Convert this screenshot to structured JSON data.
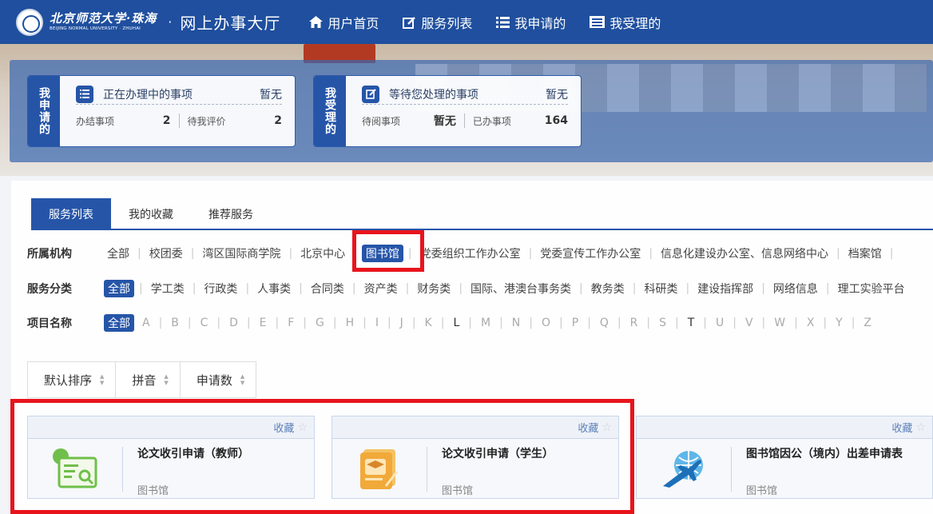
{
  "header": {
    "logo_cn": "北京师范大学·珠海",
    "logo_en": "BEIJING NORMAL UNIVERSITY · ZHUHAI",
    "separator": "·",
    "title": "网上办事大厅",
    "nav": [
      {
        "label": "用户首页",
        "icon": "home-icon"
      },
      {
        "label": "服务列表",
        "icon": "edit-icon"
      },
      {
        "label": "我申请的",
        "icon": "list-icon"
      },
      {
        "label": "我受理的",
        "icon": "inbox-icon"
      }
    ]
  },
  "dashboard": {
    "apply": {
      "side": "我申请的",
      "title": "正在办理中的事项",
      "status": "暂无",
      "stat1_label": "办结事项",
      "stat1_value": "2",
      "stat2_label": "待我评价",
      "stat2_value": "2"
    },
    "accept": {
      "side": "我受理的",
      "title": "等待您处理的事项",
      "status": "暂无",
      "stat1_label": "待阅事项",
      "stat1_value": "暂无",
      "stat2_label": "已办事项",
      "stat2_value": "164"
    }
  },
  "tabs": [
    "服务列表",
    "我的收藏",
    "推荐服务"
  ],
  "filters": {
    "org": {
      "label": "所属机构",
      "options": [
        "全部",
        "校团委",
        "湾区国际商学院",
        "北京中心",
        "图书馆",
        "党委组织工作办公室",
        "党委宣传工作办公室",
        "信息化建设办公室、信息网络中心",
        "档案馆"
      ]
    },
    "category": {
      "label": "服务分类",
      "options": [
        "全部",
        "学工类",
        "行政类",
        "人事类",
        "合同类",
        "资产类",
        "财务类",
        "国际、港澳台事务类",
        "教务类",
        "科研类",
        "建设指挥部",
        "网络信息",
        "理工实验平台"
      ]
    },
    "name": {
      "label": "项目名称",
      "all": "全部",
      "letters": [
        "A",
        "B",
        "C",
        "D",
        "E",
        "F",
        "G",
        "H",
        "I",
        "J",
        "K",
        "L",
        "M",
        "N",
        "O",
        "P",
        "Q",
        "R",
        "S",
        "T",
        "U",
        "V",
        "W",
        "X",
        "Y",
        "Z"
      ]
    }
  },
  "sort": [
    "默认排序",
    "拼音",
    "申请数"
  ],
  "cards": [
    {
      "title": "论文收引申请（教师）",
      "dept": "图书馆",
      "fav": "收藏",
      "icon": "teacher-certificate-icon"
    },
    {
      "title": "论文收引申请（学生）",
      "dept": "图书馆",
      "fav": "收藏",
      "icon": "student-certificate-icon"
    },
    {
      "title": "图书馆因公（境内）出差申请表",
      "dept": "图书馆",
      "fav": "收藏",
      "icon": "airplane-globe-icon"
    }
  ],
  "colors": {
    "primary": "#2655a8",
    "header": "#1f4f9e",
    "highlight": "#e8141c"
  }
}
